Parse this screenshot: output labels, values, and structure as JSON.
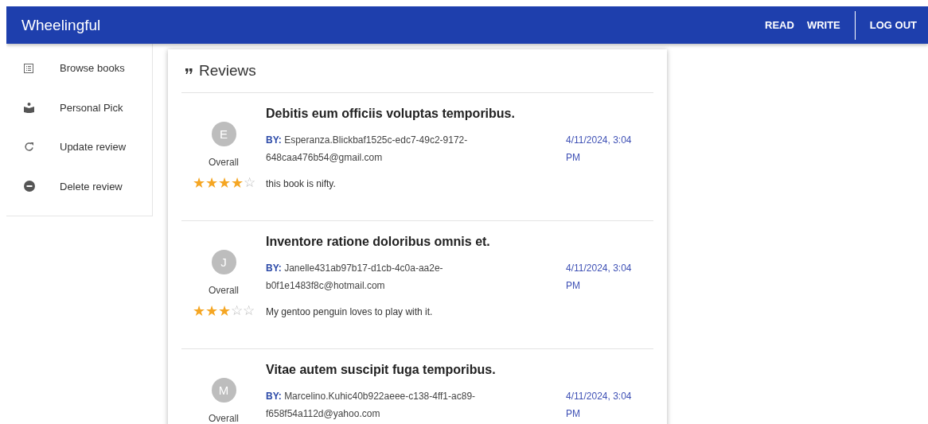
{
  "app_bar": {
    "title": "Wheelingful",
    "nav": [
      {
        "label": "READ"
      },
      {
        "label": "WRITE"
      },
      {
        "label": "LOG OUT"
      }
    ]
  },
  "sidebar": {
    "items": [
      {
        "label": "Browse books",
        "kind": "list"
      },
      {
        "label": "Personal Pick",
        "kind": "reader"
      },
      {
        "label": "Update review",
        "kind": "update"
      },
      {
        "label": "Delete review",
        "kind": "delete"
      }
    ]
  },
  "reviews": {
    "title": "Reviews",
    "items": [
      {
        "avatar": "E",
        "rating_label": "Overall",
        "stars": 4,
        "title": "Debitis eum officiis voluptas temporibus.",
        "by_label": "BY:",
        "author": "Esperanza.Blickbaf1525c-edc7-49c2-9172-648caa476b54@gmail.com",
        "date": "4/11/2024, 3:04 PM",
        "body": "this book is nifty."
      },
      {
        "avatar": "J",
        "rating_label": "Overall",
        "stars": 3,
        "title": "Inventore ratione doloribus omnis et.",
        "by_label": "BY:",
        "author": "Janelle431ab97b17-d1cb-4c0a-aa2e-b0f1e1483f8c@hotmail.com",
        "date": "4/11/2024, 3:04 PM",
        "body": "My gentoo penguin loves to play with it."
      },
      {
        "avatar": "M",
        "rating_label": "Overall",
        "title": "Vitae autem suscipit fuga temporibus.",
        "by_label": "BY:",
        "author": "Marcelino.Kuhic40b922aeee-c138-4ff1-ac89-f658f54a112d@yahoo.com",
        "date": "4/11/2024, 3:04 PM"
      }
    ]
  }
}
